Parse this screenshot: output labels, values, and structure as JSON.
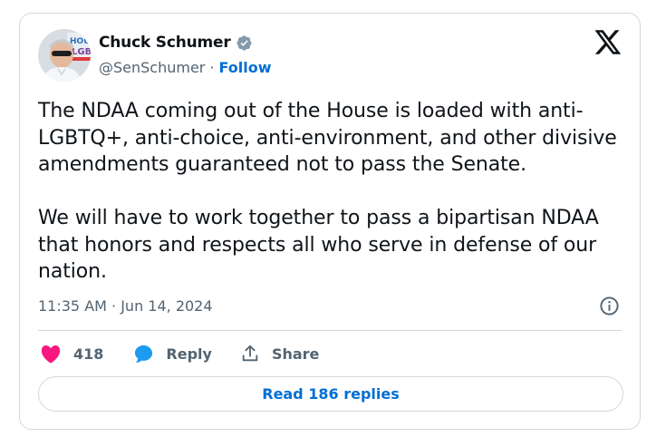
{
  "author": {
    "name": "Chuck Schumer",
    "handle": "@SenSchumer",
    "separator": "·",
    "follow_label": "Follow",
    "avatar_sign_text": "HOU\nLGBT"
  },
  "tweet": {
    "text": "The NDAA coming out of the House is loaded with anti-LGBTQ+, anti-choice, anti-environment, and other divisive amendments guaranteed not to pass the Senate.\n\nWe will have to work together to pass a bipartisan NDAA that honors and respects all who serve in defense of our nation.",
    "timestamp": "11:35 AM · Jun 14, 2024"
  },
  "actions": {
    "likes_count": "418",
    "reply_label": "Reply",
    "share_label": "Share"
  },
  "read_replies_label": "Read 186 replies",
  "colors": {
    "accent": "#006fd6",
    "verified": "#829aab",
    "heart": "#f91880",
    "reply_bubble": "#1d9bf0",
    "muted_text": "#536471",
    "border": "#cfd9de"
  },
  "icons": {
    "verified": "verified-badge-icon",
    "x_logo": "x-logo-icon",
    "info": "info-icon",
    "heart": "heart-icon",
    "reply": "reply-bubble-icon",
    "share": "share-icon"
  }
}
